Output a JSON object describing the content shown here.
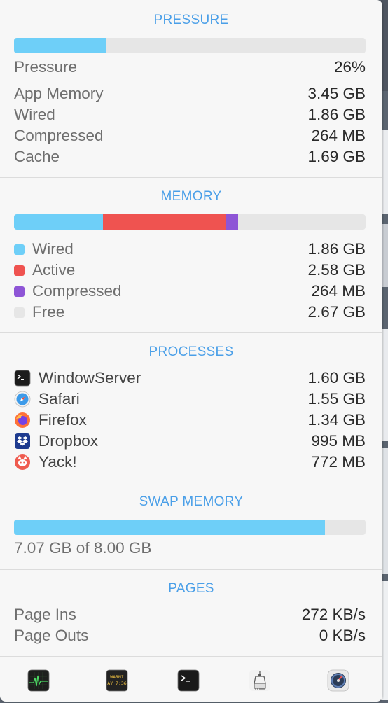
{
  "pressure": {
    "title": "PRESSURE",
    "bar_fraction": 0.26,
    "bar_color": "#6ecff8",
    "rows": [
      {
        "label": "Pressure",
        "value": "26%"
      },
      {
        "label": "App Memory",
        "value": "3.45 GB"
      },
      {
        "label": "Wired",
        "value": "1.86 GB"
      },
      {
        "label": "Compressed",
        "value": "264 MB"
      },
      {
        "label": "Cache",
        "value": "1.69 GB"
      }
    ]
  },
  "memory": {
    "title": "MEMORY",
    "total_gb": 7.37,
    "items": [
      {
        "label": "Wired",
        "value": "1.86 GB",
        "gb": 1.86,
        "color": "#6ecff8"
      },
      {
        "label": "Active",
        "value": "2.58 GB",
        "gb": 2.58,
        "color": "#ef5350"
      },
      {
        "label": "Compressed",
        "value": "264 MB",
        "gb": 0.26,
        "color": "#8e55d6"
      },
      {
        "label": "Free",
        "value": "2.67 GB",
        "gb": 2.67,
        "color": "#e6e6e6"
      }
    ]
  },
  "processes": {
    "title": "PROCESSES",
    "items": [
      {
        "name": "WindowServer",
        "value": "1.60 GB",
        "icon": "terminal-icon"
      },
      {
        "name": "Safari",
        "value": "1.55 GB",
        "icon": "safari-icon"
      },
      {
        "name": "Firefox",
        "value": "1.34 GB",
        "icon": "firefox-icon"
      },
      {
        "name": "Dropbox",
        "value": "995 MB",
        "icon": "dropbox-icon"
      },
      {
        "name": "Yack!",
        "value": "772 MB",
        "icon": "yack-icon"
      }
    ]
  },
  "swap": {
    "title": "SWAP MEMORY",
    "used_gb": 7.07,
    "total_gb": 8.0,
    "bar_color": "#6ecff8",
    "summary": "7.07 GB of 8.00 GB"
  },
  "pages": {
    "title": "PAGES",
    "rows": [
      {
        "label": "Page Ins",
        "value": "272 KB/s"
      },
      {
        "label": "Page Outs",
        "value": "0 KB/s"
      }
    ]
  },
  "toolbar": {
    "buttons": [
      {
        "icon": "activity-monitor-icon",
        "caption": ""
      },
      {
        "icon": "console-icon",
        "caption": "WARNI\nAY 7:36"
      },
      {
        "icon": "terminal-icon",
        "caption": ""
      },
      {
        "icon": "system-information-icon",
        "caption": ""
      },
      {
        "icon": "disk-utility-icon",
        "caption": ""
      }
    ]
  }
}
